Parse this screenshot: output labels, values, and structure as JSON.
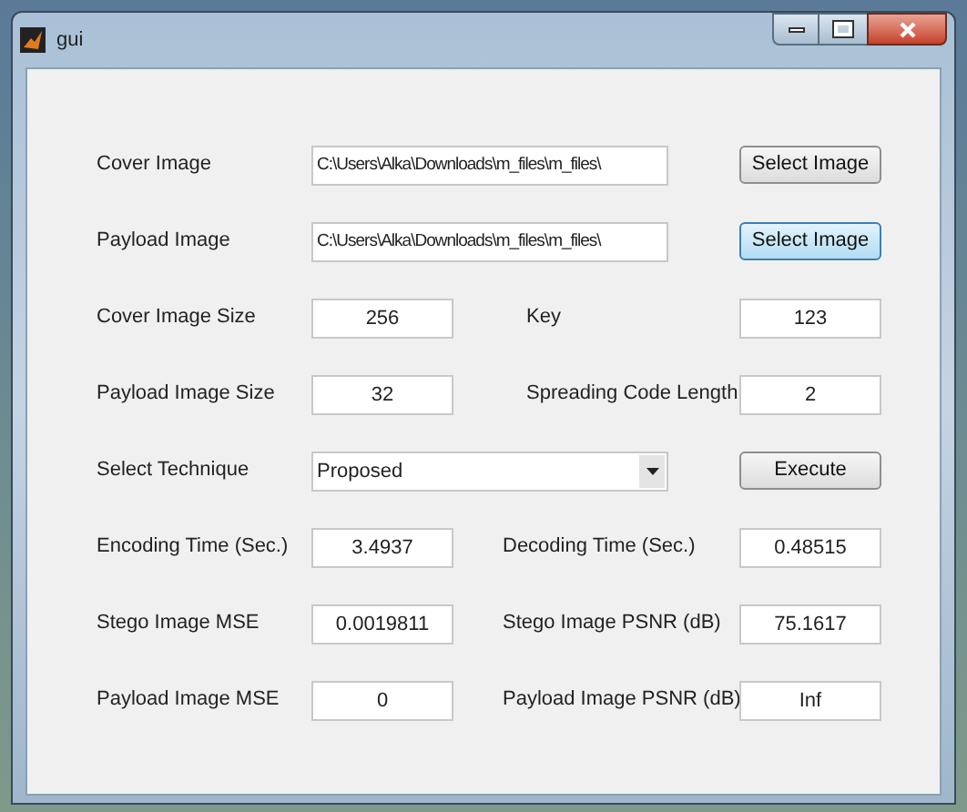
{
  "window": {
    "title": "gui"
  },
  "file_inputs": [
    {
      "label": "Cover Image",
      "value": "C:\\Users\\Alka\\Downloads\\m_files\\m_files\\",
      "button": "Select Image",
      "highlighted": false
    },
    {
      "label": "Payload Image",
      "value": "C:\\Users\\Alka\\Downloads\\m_files\\m_files\\",
      "button": "Select Image",
      "highlighted": true
    }
  ],
  "parameters": [
    {
      "label": "Cover Image Size",
      "value": "256",
      "label_2": "Key",
      "value_2": "123"
    },
    {
      "label": "Payload Image Size",
      "value": "32",
      "label_2": "Spreading Code Length",
      "value_2": "2"
    }
  ],
  "technique": {
    "label": "Select Technique",
    "value": "Proposed",
    "button": "Execute"
  },
  "results": [
    {
      "label": "Encoding Time (Sec.)",
      "value": "3.4937",
      "label_2": "Decoding Time (Sec.)",
      "value_2": "0.48515"
    },
    {
      "label": "Stego Image MSE",
      "value": "0.0019811",
      "label_2": "Stego Image PSNR (dB)",
      "value_2": "75.1617"
    },
    {
      "label": "Payload Image MSE",
      "value": "0",
      "label_2": "Payload Image PSNR (dB)",
      "value_2": "Inf"
    }
  ]
}
